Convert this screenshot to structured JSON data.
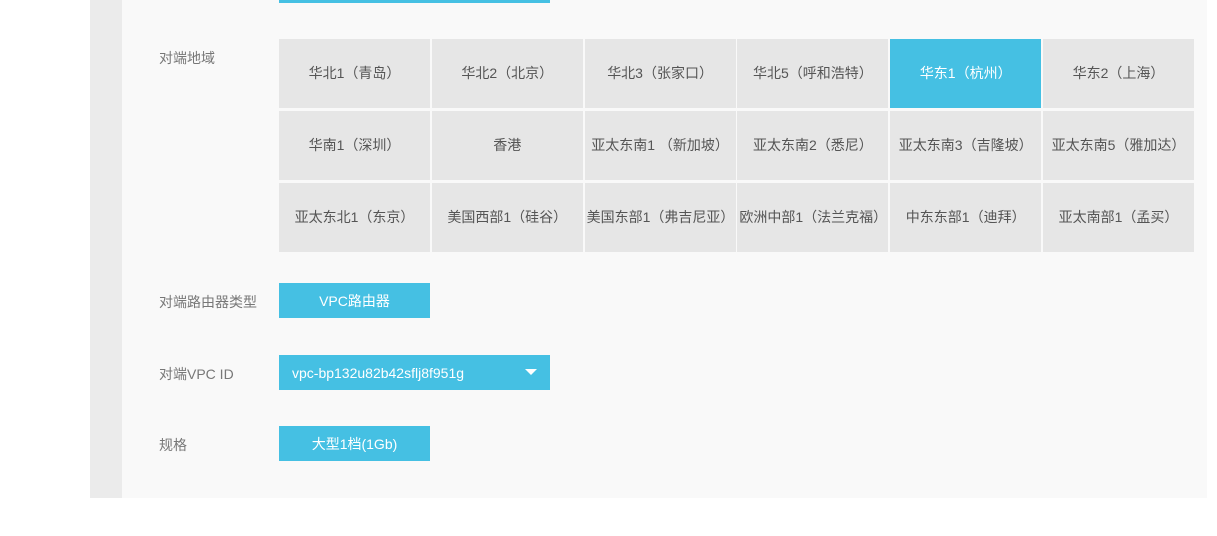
{
  "form": {
    "peer_region_label": "对端地域",
    "peer_router_type_label": "对端路由器类型",
    "peer_vpc_id_label": "对端VPC ID",
    "spec_label": "规格"
  },
  "regions": [
    {
      "label": "华北1（青岛）",
      "selected": false
    },
    {
      "label": "华北2（北京）",
      "selected": false
    },
    {
      "label": "华北3（张家口）",
      "selected": false
    },
    {
      "label": "华北5（呼和浩特）",
      "selected": false
    },
    {
      "label": "华东1（杭州）",
      "selected": true
    },
    {
      "label": "华东2（上海）",
      "selected": false
    },
    {
      "label": "华南1（深圳）",
      "selected": false
    },
    {
      "label": "香港",
      "selected": false
    },
    {
      "label": "亚太东南1 （新加坡）",
      "selected": false
    },
    {
      "label": "亚太东南2（悉尼）",
      "selected": false
    },
    {
      "label": "亚太东南3（吉隆坡）",
      "selected": false
    },
    {
      "label": "亚太东南5（雅加达）",
      "selected": false
    },
    {
      "label": "亚太东北1（东京）",
      "selected": false
    },
    {
      "label": "美国西部1（硅谷）",
      "selected": false
    },
    {
      "label": "美国东部1（弗吉尼亚）",
      "selected": false
    },
    {
      "label": "欧洲中部1（法兰克福）",
      "selected": false
    },
    {
      "label": "中东东部1（迪拜）",
      "selected": false
    },
    {
      "label": "亚太南部1（孟买）",
      "selected": false
    }
  ],
  "router_type": {
    "value": "VPC路由器"
  },
  "vpc_select": {
    "value": "vpc-bp132u82b42sflj8f951g",
    "icon": "caret-down-icon"
  },
  "spec": {
    "value": "大型1档(1Gb)"
  },
  "colors": {
    "accent": "#45c0e3",
    "cell_bg": "#e6e6e6",
    "panel_bg": "#f9f9f9",
    "label_text": "#777777"
  }
}
